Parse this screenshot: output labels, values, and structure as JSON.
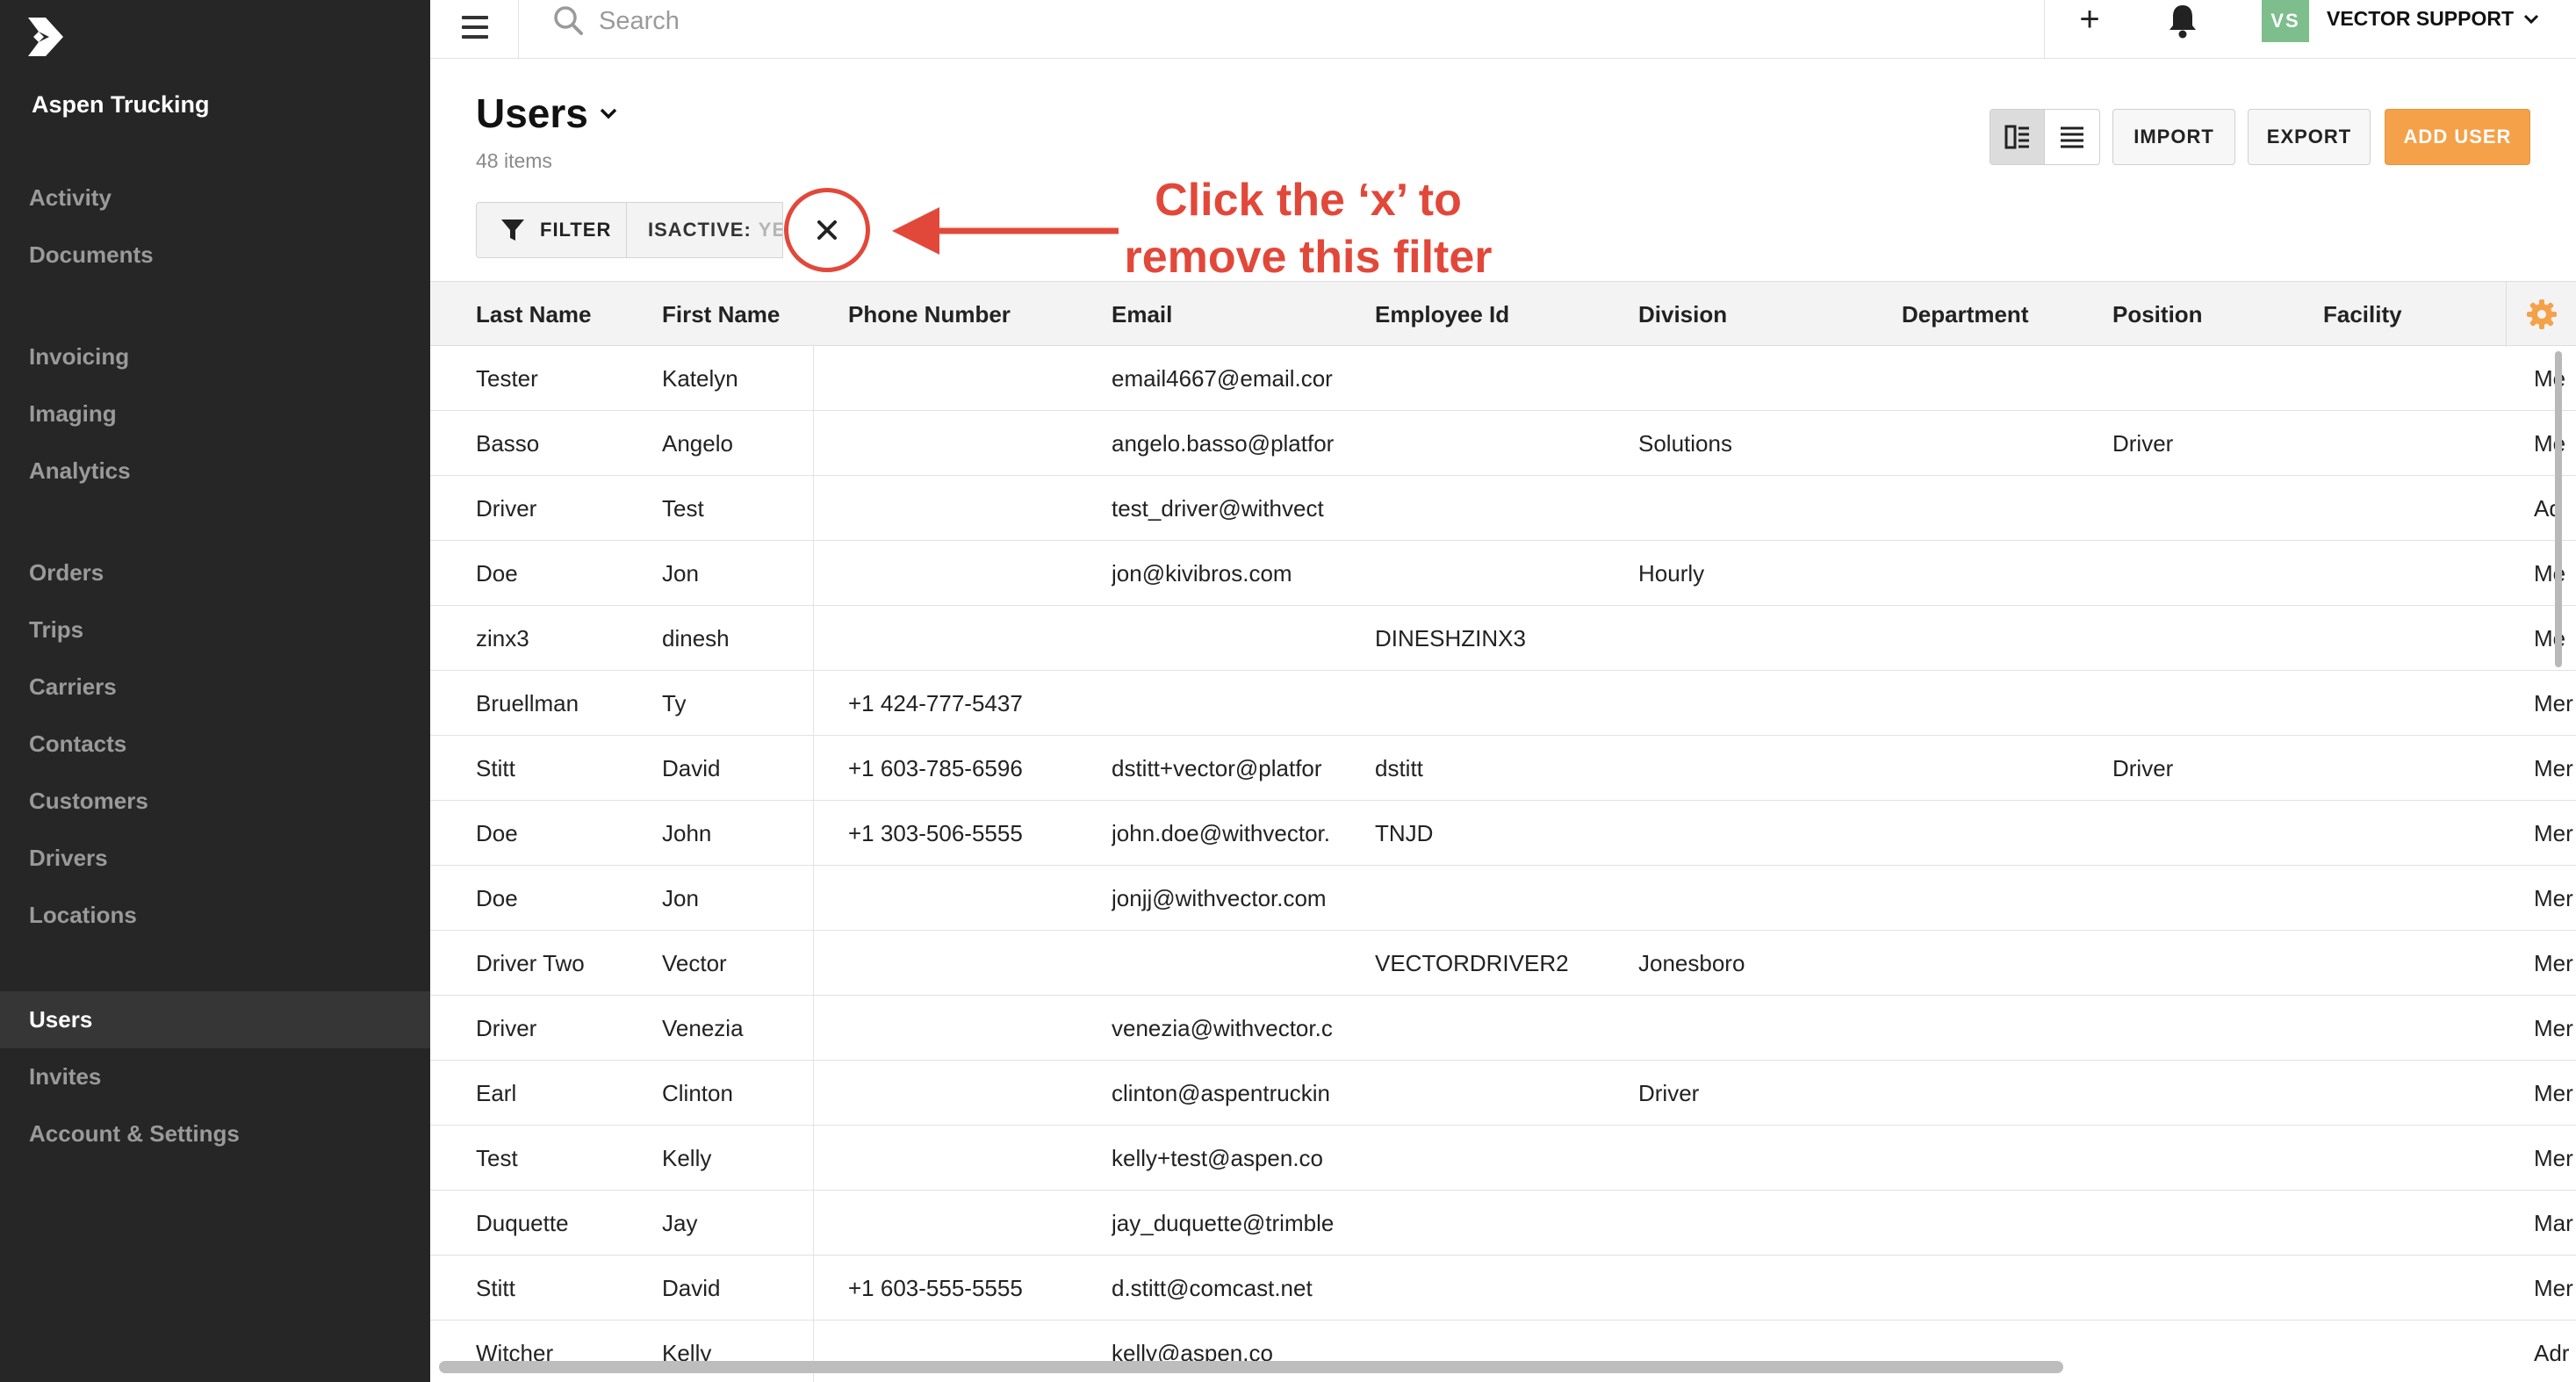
{
  "sidebar": {
    "org_name": "Aspen Trucking",
    "groups": [
      [
        "Activity",
        "Documents"
      ],
      [
        "Invoicing",
        "Imaging",
        "Analytics"
      ],
      [
        "Orders",
        "Trips",
        "Carriers",
        "Contacts",
        "Customers",
        "Drivers",
        "Locations"
      ],
      [
        "Users",
        "Invites",
        "Account & Settings"
      ]
    ],
    "active": "Users"
  },
  "topbar": {
    "search_placeholder": "Search",
    "avatar_initials": "VS",
    "user_name": "VECTOR SUPPORT",
    "plus_icon": "plus-icon",
    "bell_icon": "bell-icon"
  },
  "page": {
    "title": "Users",
    "count": "48 items",
    "import_label": "IMPORT",
    "export_label": "EXPORT",
    "add_label": "ADD USER"
  },
  "filter": {
    "button_label": "FILTER",
    "chip_key": "ISACTIVE:",
    "chip_value": "YES"
  },
  "annotation": {
    "line1": "Click the ‘x’ to",
    "line2": "remove this filter",
    "color": "#e2483a"
  },
  "colors": {
    "accent": "#f5a14a",
    "sidebar_bg": "#262626",
    "avatar_bg": "#7dbe8c"
  },
  "table": {
    "columns": [
      "Last Name",
      "First Name",
      "Phone Number",
      "Email",
      "Employee Id",
      "Division",
      "Department",
      "Position",
      "Facility"
    ],
    "rows": [
      [
        "Tester",
        "Katelyn",
        "",
        "email4667@email.cor",
        "",
        "",
        "",
        "",
        "",
        "Me"
      ],
      [
        "Basso",
        "Angelo",
        "",
        "angelo.basso@platfor",
        "",
        "Solutions",
        "",
        "Driver",
        "",
        "Me"
      ],
      [
        "Driver",
        "Test",
        "",
        "test_driver@withvect",
        "",
        "",
        "",
        "",
        "",
        "Ad"
      ],
      [
        "Doe",
        "Jon",
        "",
        "jon@kivibros.com",
        "",
        "Hourly",
        "",
        "",
        "",
        "Me"
      ],
      [
        "zinx3",
        "dinesh",
        "",
        "",
        "DINESHZINX3",
        "",
        "",
        "",
        "",
        "Me"
      ],
      [
        "Bruellman",
        "Ty",
        "+1 424-777-5437",
        "",
        "",
        "",
        "",
        "",
        "",
        "Mer"
      ],
      [
        "Stitt",
        "David",
        "+1 603-785-6596",
        "dstitt+vector@platfor",
        "dstitt",
        "",
        "",
        "Driver",
        "",
        "Mer"
      ],
      [
        "Doe",
        "John",
        "+1 303-506-5555",
        "john.doe@withvector.",
        "TNJD",
        "",
        "",
        "",
        "",
        "Mer"
      ],
      [
        "Doe",
        "Jon",
        "",
        "jonjj@withvector.com",
        "",
        "",
        "",
        "",
        "",
        "Mer"
      ],
      [
        "Driver Two",
        "Vector",
        "",
        "",
        "VECTORDRIVER2",
        "Jonesboro",
        "",
        "",
        "",
        "Mer"
      ],
      [
        "Driver",
        "Venezia",
        "",
        "venezia@withvector.c",
        "",
        "",
        "",
        "",
        "",
        "Mer"
      ],
      [
        "Earl",
        "Clinton",
        "",
        "clinton@aspentruckin",
        "",
        "Driver",
        "",
        "",
        "",
        "Mer"
      ],
      [
        "Test",
        "Kelly",
        "",
        "kelly+test@aspen.co",
        "",
        "",
        "",
        "",
        "",
        "Mer"
      ],
      [
        "Duquette",
        "Jay",
        "",
        "jay_duquette@trimble",
        "",
        "",
        "",
        "",
        "",
        "Mar"
      ],
      [
        "Stitt",
        "David",
        "+1 603-555-5555",
        "d.stitt@comcast.net",
        "",
        "",
        "",
        "",
        "",
        "Mer"
      ],
      [
        "Witcher",
        "Kelly",
        "",
        "kelly@aspen.co",
        "",
        "",
        "",
        "",
        "",
        "Adr"
      ]
    ]
  }
}
